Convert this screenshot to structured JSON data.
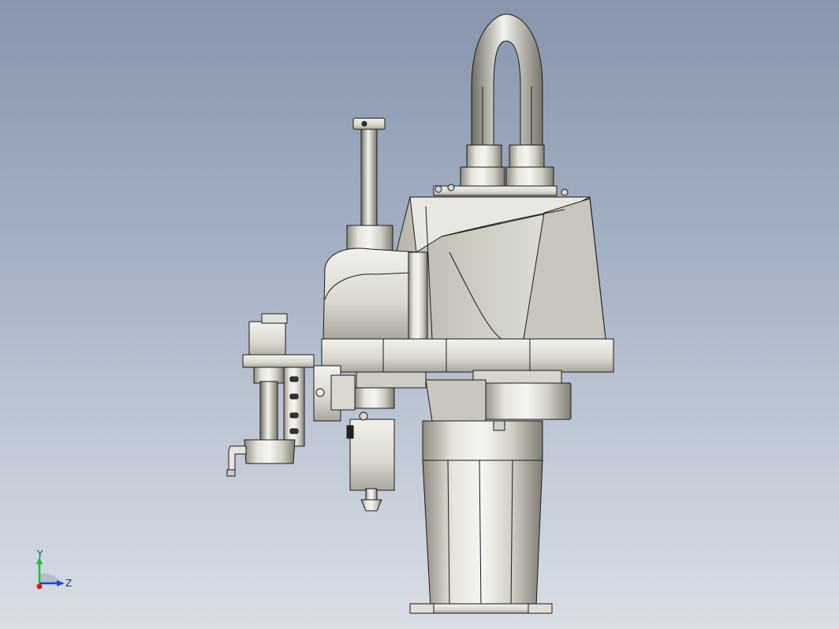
{
  "viewport": {
    "background_top": "#8796ad",
    "background_bottom": "#d9dee6",
    "model": "scara-robot-assembly"
  },
  "triad": {
    "y_label": "Y",
    "z_label": "Z",
    "colors": {
      "y": "#1fbf3a",
      "z": "#1f45d6",
      "x": "#d81e1e"
    }
  }
}
